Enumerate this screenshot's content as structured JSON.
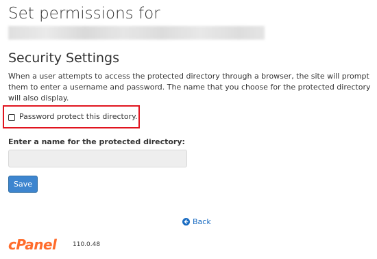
{
  "header": {
    "title": "Set permissions for"
  },
  "security": {
    "heading": "Security Settings",
    "description": "When a user attempts to access the protected directory through a browser, the site will prompt them to enter a username and password. The name that you choose for the protected directory will also display.",
    "checkbox_label": "Password protect this directory.",
    "checkbox_checked": false,
    "highlight_color": "#e0141e",
    "name_label": "Enter a name for the protected directory:",
    "name_value": ""
  },
  "actions": {
    "save_label": "Save",
    "back_label": "Back"
  },
  "footer": {
    "logo_text": "cPanel",
    "version": "110.0.48"
  },
  "colors": {
    "primary_button": "#3d85cf",
    "link": "#1a6cc2",
    "brand": "#ff6c2c"
  }
}
